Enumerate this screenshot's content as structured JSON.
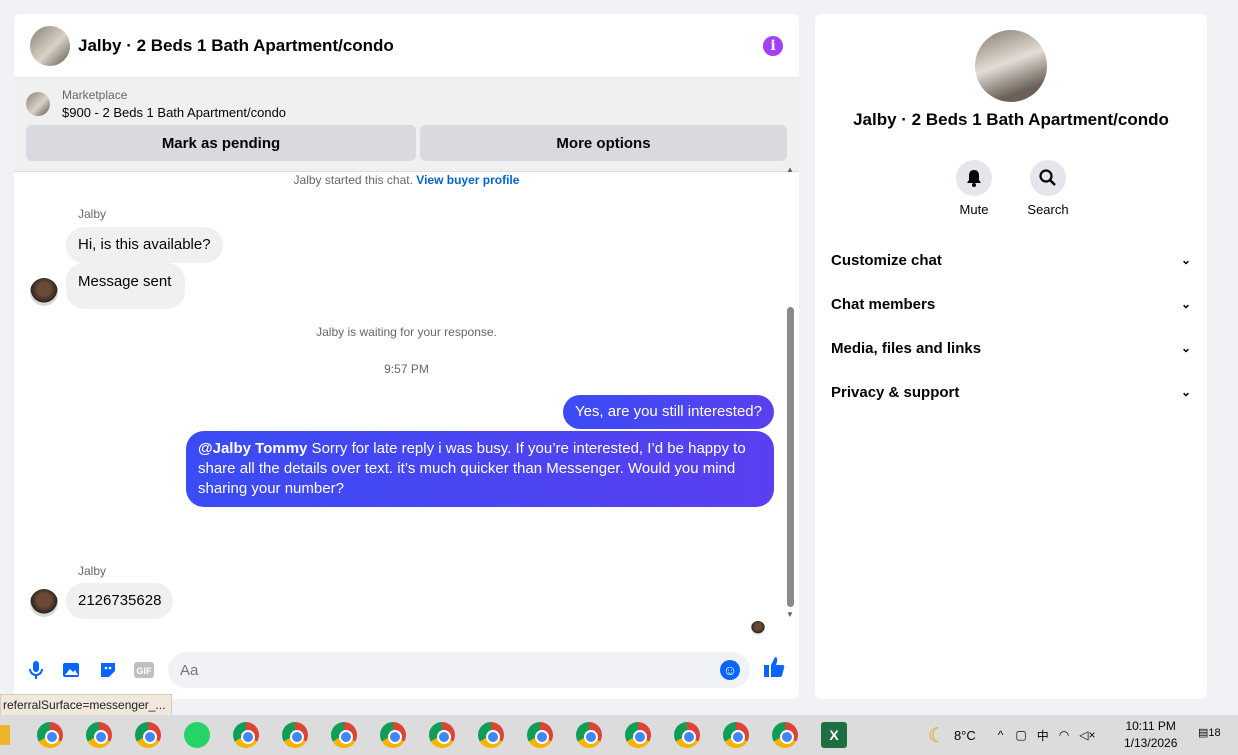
{
  "chat": {
    "title": "Jalby · 2 Beds 1 Bath Apartment/condo",
    "marketplace_label": "Marketplace",
    "listing": "$900 - 2 Beds 1 Bath Apartment/condo",
    "mark_pending": "Mark as pending",
    "more_options": "More options",
    "started_text": "Jalby started this chat.",
    "view_buyer": "View buyer profile",
    "sender_name": "Jalby",
    "msg1": "Hi, is this available?",
    "msg2": "Message sent",
    "waiting": "Jalby is waiting for your response.",
    "time": "9:57 PM",
    "out1": "Yes, are you still interested?",
    "out2_mention": "@Jalby Tommy",
    "out2_text": " Sorry for late reply i was busy. If you’re interested, I’d be happy to share all the details over text. it’s much quicker than Messenger. Would you mind sharing your number?",
    "sender_name2": "Jalby",
    "msg3": "2126735628",
    "input_placeholder": "Aa"
  },
  "tooltip": "referralSurface=messenger_...",
  "side": {
    "title": "Jalby · 2 Beds 1 Bath Apartment/condo",
    "mute": "Mute",
    "search": "Search",
    "menu": [
      "Customize chat",
      "Chat members",
      "Media, files and links",
      "Privacy & support"
    ]
  },
  "taskbar": {
    "weather": "8°C",
    "time": "10:11 PM",
    "date": "1/13/2026",
    "notifications": "18"
  }
}
